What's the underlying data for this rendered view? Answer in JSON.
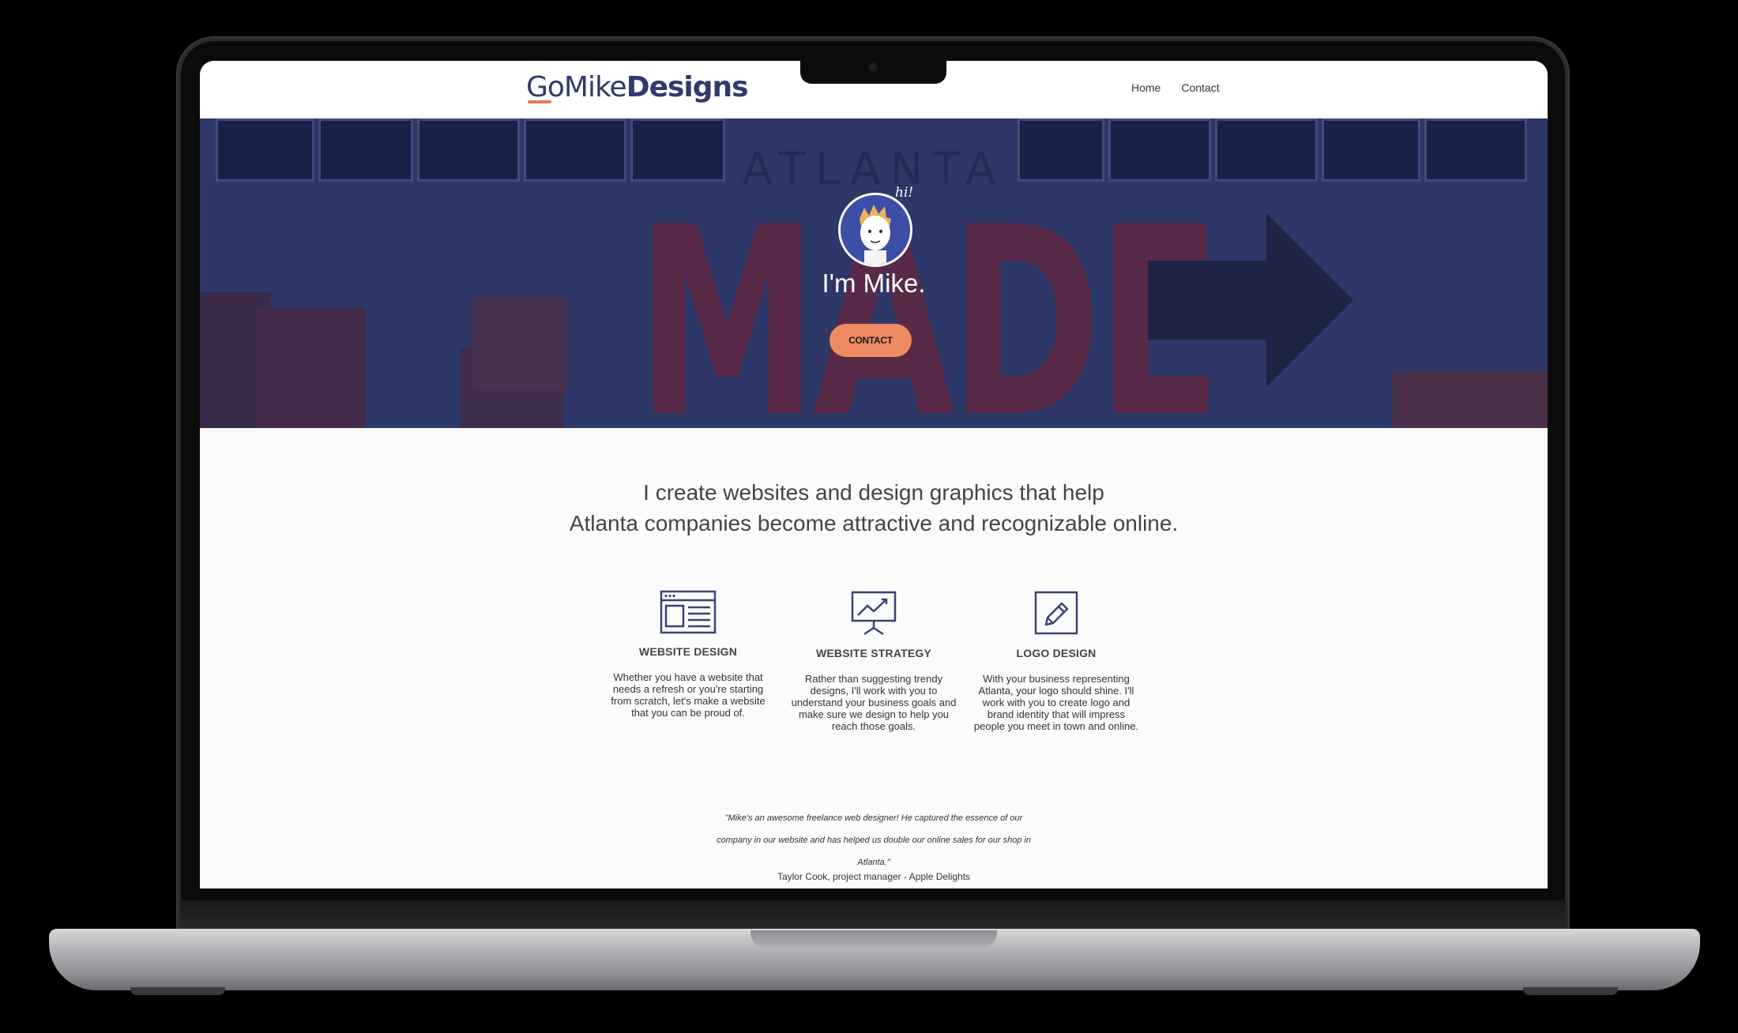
{
  "header": {
    "logo_part1": "GoMike",
    "logo_part2": "Designs",
    "nav": [
      "Home",
      "Contact"
    ]
  },
  "hero": {
    "wall_text_top": "ATLANTA",
    "wall_text_big": "MADE",
    "greeting_badge": "hi!",
    "title": "I'm Mike.",
    "cta_label": "CONTACT"
  },
  "tagline": {
    "line1": "I create websites and design graphics that help",
    "line2": "Atlanta companies become attractive and recognizable online."
  },
  "services": [
    {
      "icon": "website-layout-icon",
      "title": "WEBSITE DESIGN",
      "text": "Whether you have a website that needs a refresh or you're starting from scratch, let's make a website that you can be proud of."
    },
    {
      "icon": "presentation-chart-icon",
      "title": "WEBSITE STRATEGY",
      "text": "Rather than suggesting trendy designs, I'll work with you to understand your business goals and make sure we design to help you reach those goals."
    },
    {
      "icon": "pencil-icon",
      "title": "LOGO DESIGN",
      "text": "With your business representing Atlanta, your logo should shine. I'll work with you to create logo and brand identity that will impress people you meet in town and online."
    }
  ],
  "testimonial": {
    "line1": "\"Mike's an awesome freelance web designer! He captured the essence of our",
    "line2": "company in our website and has helped us double our online sales for our shop in",
    "line3": "Atlanta.\"",
    "author": "Taylor Cook, project manager - Apple Delights"
  },
  "colors": {
    "brand_navy": "#2f3a6e",
    "accent_orange": "#ee8a62",
    "hero_overlay": "#2d3768"
  }
}
